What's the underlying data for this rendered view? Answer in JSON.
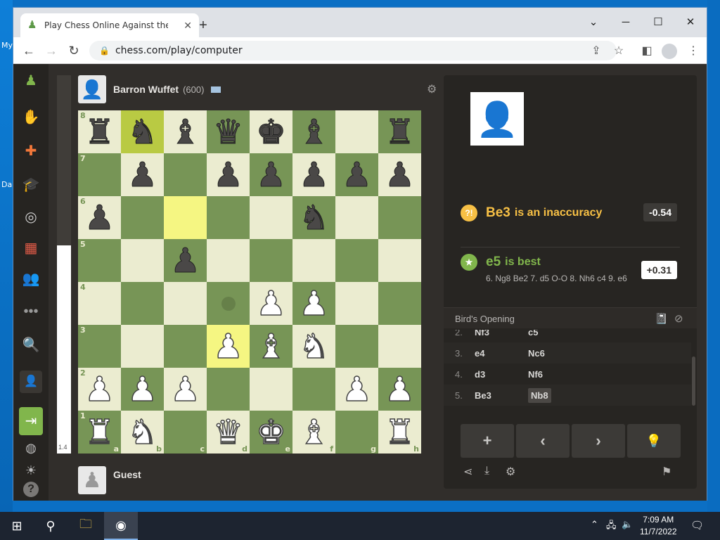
{
  "desktop": {
    "label_1": "My",
    "label_2": "Da"
  },
  "browser": {
    "tab_title": "Play Chess Online Against the Co",
    "url": "chess.com/play/computer"
  },
  "sidebar": {
    "items": [
      "logo",
      "play",
      "puzzles",
      "learn",
      "watch",
      "news",
      "social",
      "more",
      "search",
      "add-friend",
      "sign-in",
      "globe",
      "theme",
      "help"
    ]
  },
  "eval_bar": {
    "label": "1.4",
    "white_fraction": 0.55
  },
  "players": {
    "top": {
      "name": "Barron Wuffet",
      "rating": "(600)"
    },
    "bottom": {
      "name": "Guest"
    }
  },
  "board": {
    "ranks": [
      "8",
      "7",
      "6",
      "5",
      "4",
      "3",
      "2",
      "1"
    ],
    "files": [
      "a",
      "b",
      "c",
      "d",
      "e",
      "f",
      "g",
      "h"
    ],
    "position": [
      [
        "bR",
        "bN",
        "bB",
        "bQ",
        "bK",
        "bB",
        "",
        "bR"
      ],
      [
        "",
        "bP",
        "",
        "bP",
        "bP",
        "bP",
        "bP",
        "bP"
      ],
      [
        "bP",
        "",
        "",
        "",
        "",
        "bN",
        "",
        ""
      ],
      [
        "",
        "",
        "bP",
        "",
        "",
        "",
        "",
        ""
      ],
      [
        "",
        "",
        "",
        "dot",
        "wP",
        "wP",
        "",
        ""
      ],
      [
        "",
        "",
        "",
        "wP",
        "wB",
        "wN",
        "",
        ""
      ],
      [
        "wP",
        "wP",
        "wP",
        "",
        "",
        "",
        "wP",
        "wP"
      ],
      [
        "wR",
        "wN",
        "",
        "wQ",
        "wK",
        "wB",
        "",
        "wR"
      ]
    ],
    "highlights": [
      "b8",
      "c6",
      "d3"
    ]
  },
  "coach": {
    "played_move": "Be3",
    "played_text": "is an inaccuracy",
    "played_badge": "?!",
    "played_score": "-0.54",
    "best_move": "e5",
    "best_text": "is best",
    "best_badge": "★",
    "best_score": "+0.31",
    "best_line": "6. Ng8 Be2 7. d5 O-O 8. Nh6 c4 9. e6"
  },
  "opening": {
    "name": "Bird's Opening"
  },
  "moves": [
    {
      "num": "2.",
      "white": "Nf3",
      "black": "c5"
    },
    {
      "num": "3.",
      "white": "e4",
      "black": "Nc6"
    },
    {
      "num": "4.",
      "white": "d3",
      "black": "Nf6"
    },
    {
      "num": "5.",
      "white": "Be3",
      "black": "Nb8"
    }
  ],
  "controls": {
    "add": "+",
    "prev": "‹",
    "next": "›",
    "hint": "💡"
  },
  "taskbar": {
    "time": "7:09 AM",
    "date": "11/7/2022"
  }
}
